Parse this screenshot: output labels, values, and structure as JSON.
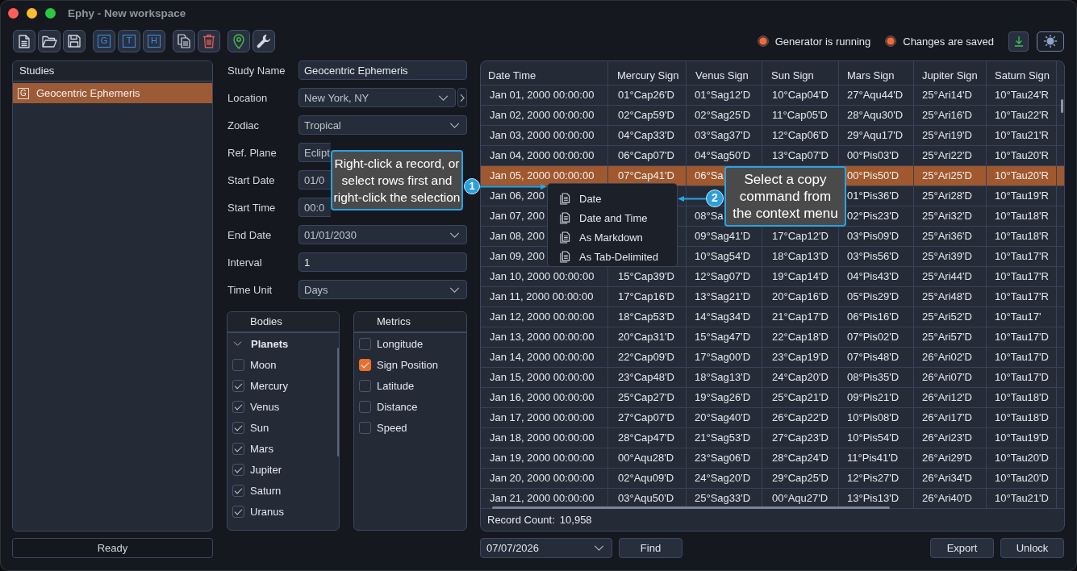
{
  "window": {
    "title": "Ephy - New workspace"
  },
  "toolbar": {
    "letter_buttons": [
      "G",
      "T",
      "H"
    ]
  },
  "indicators": [
    {
      "label": "Generator is running"
    },
    {
      "label": "Changes are saved"
    }
  ],
  "studies": {
    "title": "Studies",
    "items": [
      {
        "tag": "G",
        "name": "Geocentric Ephemeris",
        "selected": true
      }
    ]
  },
  "status_bar": {
    "text": "Ready"
  },
  "form": {
    "fields": [
      {
        "label": "Study Name",
        "kind": "text",
        "value": "Geocentric Ephemeris"
      },
      {
        "label": "Location",
        "kind": "dropdown_next",
        "value": "New York, NY"
      },
      {
        "label": "Zodiac",
        "kind": "dropdown",
        "value": "Tropical"
      },
      {
        "label": "Ref. Plane",
        "kind": "covered",
        "value": "Eclipt"
      },
      {
        "label": "Start Date",
        "kind": "covered",
        "value": "01/0"
      },
      {
        "label": "Start Time",
        "kind": "covered",
        "value": "00:0"
      },
      {
        "label": "End Date",
        "kind": "dropdown",
        "value": "01/01/2030"
      },
      {
        "label": "Interval",
        "kind": "text",
        "value": "1"
      },
      {
        "label": "Time Unit",
        "kind": "dropdown",
        "value": "Days"
      }
    ]
  },
  "bodies": {
    "title": "Bodies",
    "tree": [
      {
        "label": "Planets",
        "expanded": true,
        "children": [
          {
            "label": "Moon",
            "checked": false
          },
          {
            "label": "Mercury",
            "checked": true
          },
          {
            "label": "Venus",
            "checked": true
          },
          {
            "label": "Sun",
            "checked": true
          },
          {
            "label": "Mars",
            "checked": true
          },
          {
            "label": "Jupiter",
            "checked": true
          },
          {
            "label": "Saturn",
            "checked": true
          },
          {
            "label": "Uranus",
            "checked": true
          }
        ]
      }
    ]
  },
  "metrics": {
    "title": "Metrics",
    "items": [
      {
        "label": "Longitude",
        "checked": false
      },
      {
        "label": "Sign Position",
        "checked": true
      },
      {
        "label": "Latitude",
        "checked": false
      },
      {
        "label": "Distance",
        "checked": false
      },
      {
        "label": "Speed",
        "checked": false
      }
    ]
  },
  "table": {
    "columns": [
      "Date Time",
      "Mercury Sign",
      "Venus Sign",
      "Sun Sign",
      "Mars Sign",
      "Jupiter Sign",
      "Saturn Sign"
    ],
    "rows": [
      {
        "selected": false,
        "date_time": "Jan 01, 2000 00:00:00",
        "mercury_sign": "01°Cap26'D",
        "venus_sign": "01°Sag12'D",
        "sun_sign": "10°Cap04'D",
        "mars_sign": "27°Aqu44'D",
        "jupiter_sign": "25°Ari14'D",
        "saturn_sign": "10°Tau24'R"
      },
      {
        "selected": false,
        "date_time": "Jan 02, 2000 00:00:00",
        "mercury_sign": "02°Cap59'D",
        "venus_sign": "02°Sag25'D",
        "sun_sign": "11°Cap05'D",
        "mars_sign": "28°Aqu30'D",
        "jupiter_sign": "25°Ari16'D",
        "saturn_sign": "10°Tau22'R"
      },
      {
        "selected": false,
        "date_time": "Jan 03, 2000 00:00:00",
        "mercury_sign": "04°Cap33'D",
        "venus_sign": "03°Sag37'D",
        "sun_sign": "12°Cap06'D",
        "mars_sign": "29°Aqu17'D",
        "jupiter_sign": "25°Ari19'D",
        "saturn_sign": "10°Tau21'R"
      },
      {
        "selected": false,
        "date_time": "Jan 04, 2000 00:00:00",
        "mercury_sign": "06°Cap07'D",
        "venus_sign": "04°Sag50'D",
        "sun_sign": "13°Cap07'D",
        "mars_sign": "00°Pis03'D",
        "jupiter_sign": "25°Ari22'D",
        "saturn_sign": "10°Tau20'R"
      },
      {
        "selected": true,
        "date_time": "Jan 05, 2000 00:00:00",
        "mercury_sign": "07°Cap41'D",
        "venus_sign": "06°Sa",
        "mars_sign": "00°Pis50'D",
        "jupiter_sign": "25°Ari25'D",
        "saturn_sign": "10°Tau20'R"
      },
      {
        "selected": false,
        "date_time": "Jan 06, 200",
        "mars_sign": "01°Pis36'D",
        "jupiter_sign": "25°Ari28'D",
        "saturn_sign": "10°Tau19'R"
      },
      {
        "selected": false,
        "date_time": "Jan 07, 200",
        "venus_sign": "08°Sa",
        "mars_sign": "02°Pis23'D",
        "jupiter_sign": "25°Ari32'D",
        "saturn_sign": "10°Tau18'R"
      },
      {
        "selected": false,
        "date_time": "Jan 08, 200",
        "venus_sign": "09°Sag41'D",
        "sun_sign": "17°Cap12'D",
        "mars_sign": "03°Pis09'D",
        "jupiter_sign": "25°Ari36'D",
        "saturn_sign": "10°Tau18'R"
      },
      {
        "selected": false,
        "date_time": "Jan 09, 200",
        "venus_sign": "10°Sag54'D",
        "sun_sign": "18°Cap13'D",
        "mars_sign": "03°Pis56'D",
        "jupiter_sign": "25°Ari39'D",
        "saturn_sign": "10°Tau17'R"
      },
      {
        "selected": false,
        "date_time": "Jan 10, 2000 00:00:00",
        "mercury_sign": "15°Cap39'D",
        "venus_sign": "12°Sag07'D",
        "sun_sign": "19°Cap14'D",
        "mars_sign": "04°Pis43'D",
        "jupiter_sign": "25°Ari44'D",
        "saturn_sign": "10°Tau17'R"
      },
      {
        "selected": false,
        "date_time": "Jan 11, 2000 00:00:00",
        "mercury_sign": "17°Cap16'D",
        "venus_sign": "13°Sag21'D",
        "sun_sign": "20°Cap16'D",
        "mars_sign": "05°Pis29'D",
        "jupiter_sign": "25°Ari48'D",
        "saturn_sign": "10°Tau17'R"
      },
      {
        "selected": false,
        "date_time": "Jan 12, 2000 00:00:00",
        "mercury_sign": "18°Cap53'D",
        "venus_sign": "14°Sag34'D",
        "sun_sign": "21°Cap17'D",
        "mars_sign": "06°Pis16'D",
        "jupiter_sign": "25°Ari52'D",
        "saturn_sign": "10°Tau17'"
      },
      {
        "selected": false,
        "date_time": "Jan 13, 2000 00:00:00",
        "mercury_sign": "20°Cap31'D",
        "venus_sign": "15°Sag47'D",
        "sun_sign": "22°Cap18'D",
        "mars_sign": "07°Pis02'D",
        "jupiter_sign": "25°Ari57'D",
        "saturn_sign": "10°Tau17'D"
      },
      {
        "selected": false,
        "date_time": "Jan 14, 2000 00:00:00",
        "mercury_sign": "22°Cap09'D",
        "venus_sign": "17°Sag00'D",
        "sun_sign": "23°Cap19'D",
        "mars_sign": "07°Pis48'D",
        "jupiter_sign": "26°Ari02'D",
        "saturn_sign": "10°Tau17'D"
      },
      {
        "selected": false,
        "date_time": "Jan 15, 2000 00:00:00",
        "mercury_sign": "23°Cap48'D",
        "venus_sign": "18°Sag13'D",
        "sun_sign": "24°Cap20'D",
        "mars_sign": "08°Pis35'D",
        "jupiter_sign": "26°Ari07'D",
        "saturn_sign": "10°Tau17'D"
      },
      {
        "selected": false,
        "date_time": "Jan 16, 2000 00:00:00",
        "mercury_sign": "25°Cap27'D",
        "venus_sign": "19°Sag26'D",
        "sun_sign": "25°Cap21'D",
        "mars_sign": "09°Pis21'D",
        "jupiter_sign": "26°Ari12'D",
        "saturn_sign": "10°Tau18'D"
      },
      {
        "selected": false,
        "date_time": "Jan 17, 2000 00:00:00",
        "mercury_sign": "27°Cap07'D",
        "venus_sign": "20°Sag40'D",
        "sun_sign": "26°Cap22'D",
        "mars_sign": "10°Pis08'D",
        "jupiter_sign": "26°Ari17'D",
        "saturn_sign": "10°Tau18'D"
      },
      {
        "selected": false,
        "date_time": "Jan 18, 2000 00:00:00",
        "mercury_sign": "28°Cap47'D",
        "venus_sign": "21°Sag53'D",
        "sun_sign": "27°Cap23'D",
        "mars_sign": "10°Pis54'D",
        "jupiter_sign": "26°Ari23'D",
        "saturn_sign": "10°Tau19'D"
      },
      {
        "selected": false,
        "date_time": "Jan 19, 2000 00:00:00",
        "mercury_sign": "00°Aqu28'D",
        "venus_sign": "23°Sag06'D",
        "sun_sign": "28°Cap24'D",
        "mars_sign": "11°Pis41'D",
        "jupiter_sign": "26°Ari29'D",
        "saturn_sign": "10°Tau20'D"
      },
      {
        "selected": false,
        "date_time": "Jan 20, 2000 00:00:00",
        "mercury_sign": "02°Aqu09'D",
        "venus_sign": "24°Sag20'D",
        "sun_sign": "29°Cap25'D",
        "mars_sign": "12°Pis27'D",
        "jupiter_sign": "26°Ari34'D",
        "saturn_sign": "10°Tau20'D"
      },
      {
        "selected": false,
        "date_time": "Jan 21, 2000 00:00:00",
        "mercury_sign": "03°Aqu50'D",
        "venus_sign": "25°Sag33'D",
        "sun_sign": "00°Aqu27'D",
        "mars_sign": "13°Pis13'D",
        "jupiter_sign": "26°Ari40'D",
        "saturn_sign": "10°Tau21'D"
      }
    ],
    "record_count": {
      "label": "Record Count:",
      "value": "10,958"
    }
  },
  "find": {
    "date": "07/07/2026",
    "button": "Find"
  },
  "actions": [
    "Export",
    "Unlock"
  ],
  "context_menu": {
    "items": [
      "Date",
      "Date and Time",
      "As Markdown",
      "As Tab-Delimited"
    ]
  },
  "callouts": [
    {
      "number": "1",
      "text": "Right-click a record, or select rows first and right-click the selection"
    },
    {
      "number": "2",
      "text": "Select a copy command from the context menu"
    }
  ]
}
